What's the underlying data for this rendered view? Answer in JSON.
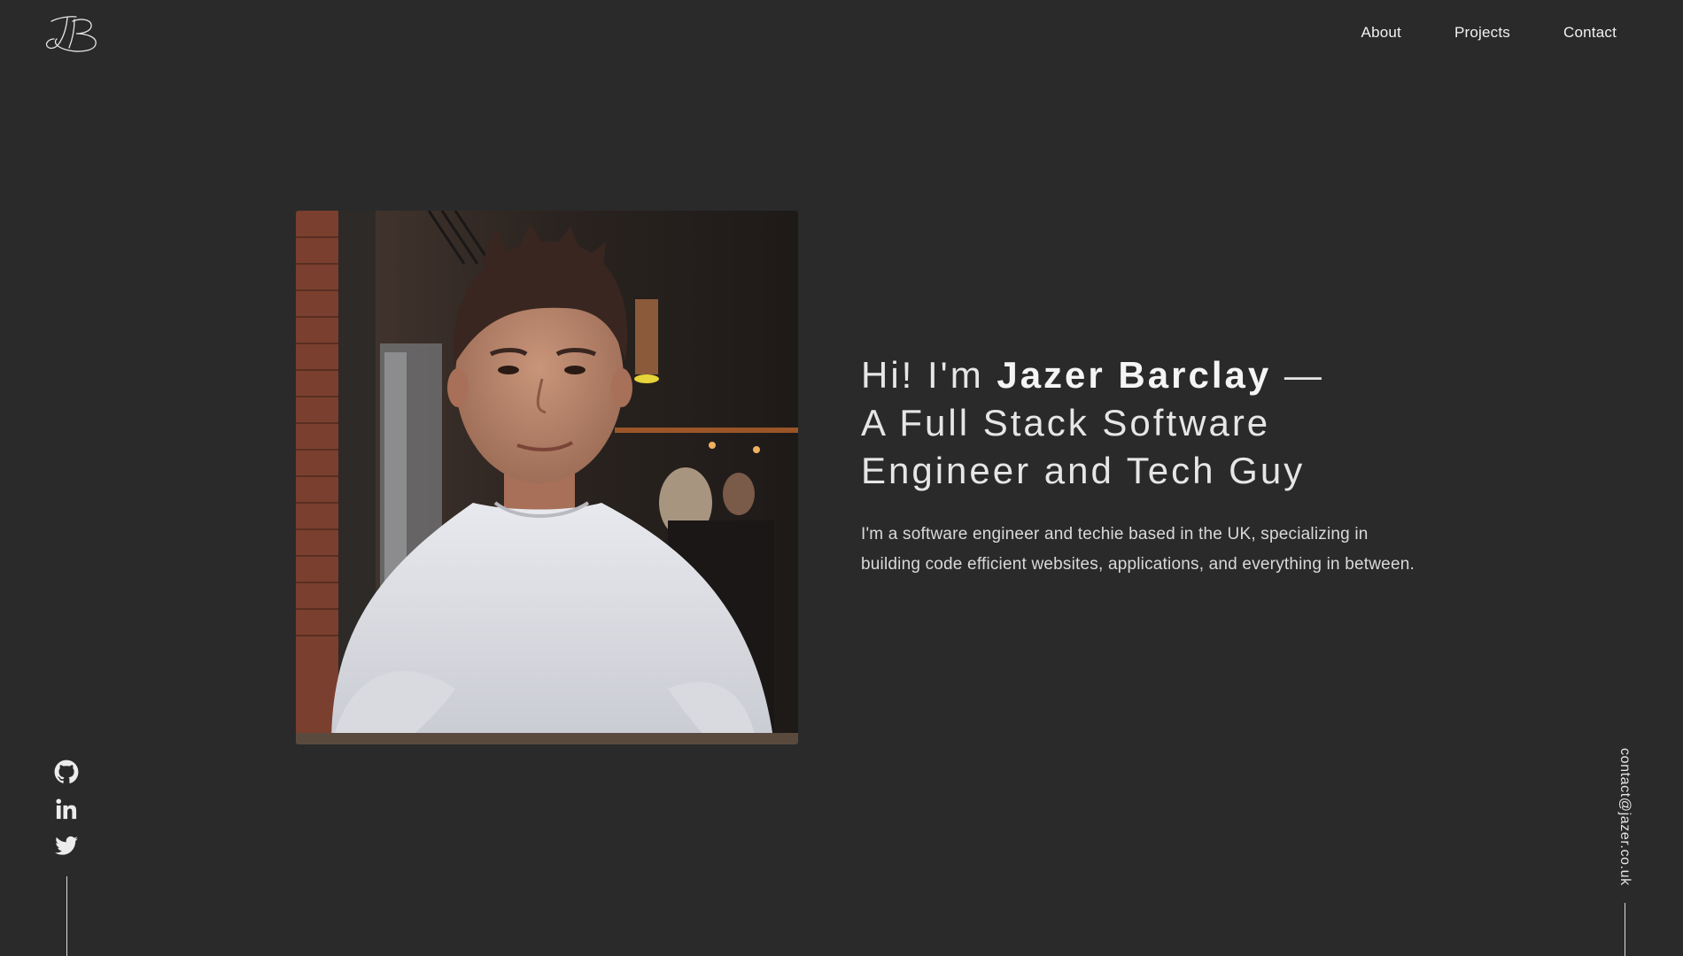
{
  "brand": {
    "logo_icon": "signature-logo-icon"
  },
  "nav": {
    "items": [
      {
        "label": "About"
      },
      {
        "label": "Projects"
      },
      {
        "label": "Contact"
      }
    ]
  },
  "hero": {
    "photo_icon": "profile-photo",
    "headline": {
      "greeting": "Hi! I'm ",
      "name": "Jazer Barclay",
      "dash": " —",
      "line2": "A Full Stack Software",
      "line3": "Engineer and Tech Guy"
    },
    "intro": "I'm a software engineer and techie based in the UK, specializing in building code efficient websites, applications, and everything in between."
  },
  "social": {
    "icons": [
      "github-icon",
      "linkedin-icon",
      "twitter-icon"
    ]
  },
  "contact": {
    "email": "contact@jazer.co.uk"
  },
  "colors": {
    "background": "#2a2a2b",
    "text": "#e8e8e8",
    "accent_line": "#dcdcdc"
  }
}
